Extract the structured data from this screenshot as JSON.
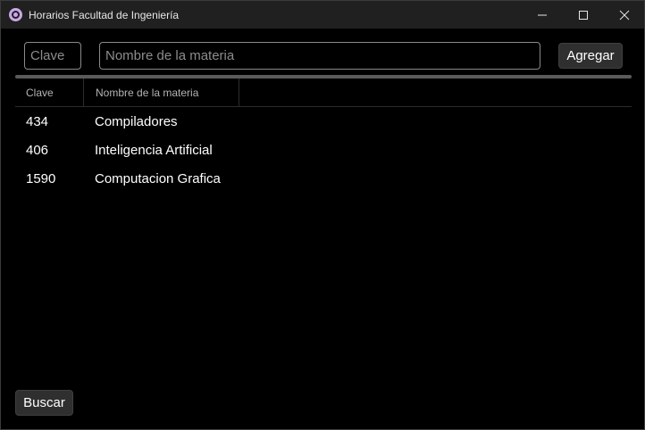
{
  "window": {
    "title": "Horarios Facultad de Ingeniería",
    "icon": "app-logo-icon",
    "accent_color": "#c9a7e8"
  },
  "form": {
    "clave_placeholder": "Clave",
    "clave_value": "",
    "nombre_placeholder": "Nombre de la materia",
    "nombre_value": "",
    "add_label": "Agregar"
  },
  "table": {
    "columns": [
      "Clave",
      "Nombre de la materia"
    ],
    "rows": [
      {
        "clave": "434",
        "nombre": "Compiladores"
      },
      {
        "clave": "406",
        "nombre": "Inteligencia Artificial"
      },
      {
        "clave": "1590",
        "nombre": "Computacion Grafica"
      }
    ]
  },
  "footer": {
    "search_label": "Buscar"
  }
}
